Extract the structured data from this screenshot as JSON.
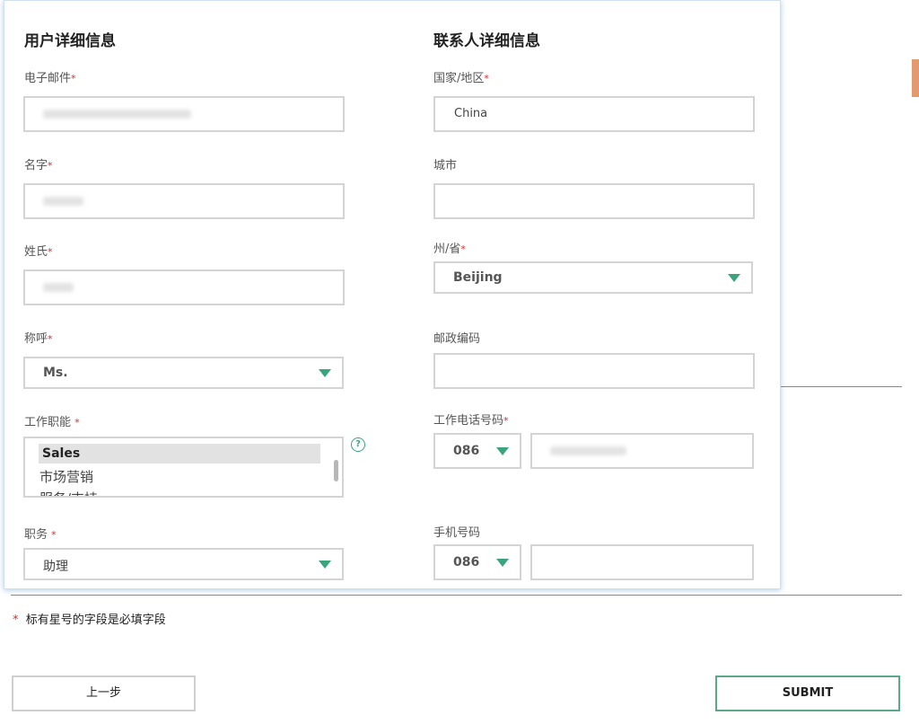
{
  "user_section": {
    "title": "用户详细信息",
    "email_label": "电子邮件",
    "firstname_label": "名字",
    "lastname_label": "姓氏",
    "salutation_label": "称呼",
    "salutation_value": "Ms.",
    "jobfunc_label": "工作职能 ",
    "jobfunc_options": [
      "Sales",
      "市场营销",
      "服务/支持"
    ],
    "position_label": "职务 ",
    "position_value": "助理"
  },
  "contact_section": {
    "title": "联系人详细信息",
    "country_label": "国家/地区",
    "country_value": "China",
    "city_label": "城市",
    "state_label": "州/省",
    "state_value": "Beijing",
    "postal_label": "邮政编码",
    "workphone_label": "工作电话号码",
    "workphone_code": "086",
    "mobile_label": "手机号码",
    "mobile_code": "086"
  },
  "required_star": "*",
  "help_glyph": "?",
  "required_note": "标有星号的字段是必填字段",
  "buttons": {
    "back": "上一步",
    "submit": "SUBMIT"
  },
  "colors": {
    "accent_green": "#3aa57c",
    "required_red": "#d32f2f",
    "side_tab": "#e39a6e"
  }
}
